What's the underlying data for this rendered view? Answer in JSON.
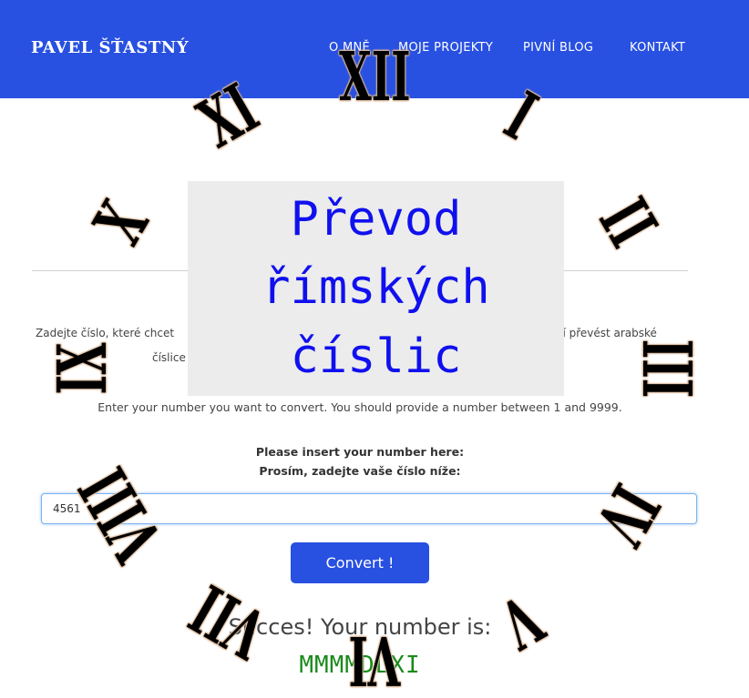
{
  "header": {
    "brand": "PAVEL ŠŤASTNÝ",
    "nav": [
      "O MNĚ",
      "MOJE PROJEKTY",
      "PIVNÍ BLOG",
      "KONTAKT"
    ]
  },
  "title": "Převod římských číslic",
  "title_lines": [
    "Převod",
    "římských",
    "číslic"
  ],
  "intro": {
    "cz_line1_left": "Zadejte číslo, které chcet",
    "cz_line1_right": "kusí převést arabské",
    "cz_line2_left": "číslice",
    "cz_line2_right": ".",
    "en": "Enter your number you want to convert. You should provide a number between 1 and 9999."
  },
  "form": {
    "prompt_en": "Please insert your number here:",
    "prompt_cz": "Prosím, zadejte vaše číslo níže:",
    "input_value": "4561",
    "convert_label": "Convert !"
  },
  "result": {
    "label": "Succes! Your number is:",
    "value": "MMMMDLXI"
  },
  "clock": {
    "numerals": [
      "XII",
      "I",
      "II",
      "III",
      "IV",
      "V",
      "VI",
      "VII",
      "VIII",
      "IX",
      "X",
      "XI"
    ]
  },
  "colors": {
    "header_bg": "#2850e1",
    "title_text": "#1010ee",
    "title_panel_bg": "#ececec",
    "result_value": "#1a8a1a",
    "button_bg": "#2850e1"
  }
}
